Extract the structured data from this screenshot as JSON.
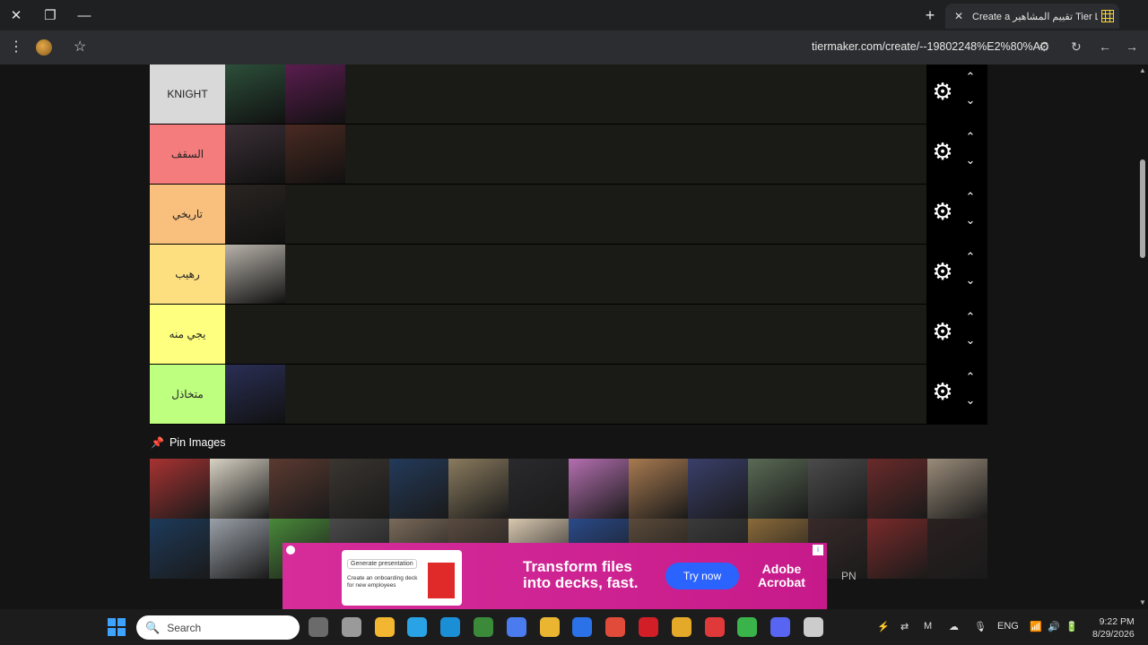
{
  "window": {
    "close_glyph": "✕",
    "restore_glyph": "❐",
    "minimize_glyph": "—"
  },
  "tab": {
    "title": "Create a تقييم المشاهير Tier List",
    "close_glyph": "✕",
    "new_tab_glyph": "+"
  },
  "address": {
    "url": "tiermaker.com/create/--19802248%E2%80%AC",
    "menu_glyph": "⋮",
    "star_glyph": "☆",
    "reload_glyph": "↻",
    "back_glyph": "←",
    "forward_glyph": "→",
    "tune_glyph": "⚙"
  },
  "tiers": [
    {
      "label": "KNIGHT",
      "color": "#d9d9d9",
      "images": [
        "#2c4f3a",
        "#5a1d4f"
      ]
    },
    {
      "label": "السقف",
      "color": "#f47c7c",
      "images": [
        "#3a2f35",
        "#4a2a22"
      ]
    },
    {
      "label": "تاريخي",
      "color": "#f9bf7c",
      "images": [
        "#2a2522"
      ]
    },
    {
      "label": "رهيب",
      "color": "#fddf7f",
      "images": [
        "#b7b2aa"
      ]
    },
    {
      "label": "يجي منه",
      "color": "#ffff7f",
      "images": []
    },
    {
      "label": "متخاذل",
      "color": "#bfff7f",
      "images": [
        "#2a2f55"
      ]
    }
  ],
  "tier_controls": {
    "gear_glyph": "⚙",
    "up_glyph": "⌃",
    "down_glyph": "⌄"
  },
  "pin": {
    "icon": "📌",
    "label": "Pin Images"
  },
  "pool_colors": [
    "#a83232",
    "#d8d2c4",
    "#5b3a30",
    "#3a3530",
    "#233a5a",
    "#8a7b5e",
    "#2a2a2e",
    "#b46fb0",
    "#a87a50",
    "#3a3f6a",
    "#5a6a55",
    "#4b4b4b",
    "#6a2a2a",
    "#9a8c7a",
    "#1d3a5a",
    "#9aa0a8",
    "#4a8a3a",
    "#4a4a4a",
    "#7a6a5a",
    "#5a4a40",
    "#d8c8b0",
    "#2a4a8a",
    "#5a4a3a",
    "#3a3a3a",
    "#8a6a3a",
    "#3a2a2a",
    "#7a2a2a",
    "#2a2020"
  ],
  "ad": {
    "card_chip": "Generate presentation",
    "card_text": "Create an onboarding deck for new employees",
    "headline_line1": "Transform files",
    "headline_line2": "into decks, fast.",
    "cta": "Try now",
    "brand_line1": "Adobe",
    "brand_line2": "Acrobat"
  },
  "side_text": "PN",
  "taskbar": {
    "search_placeholder": "Search",
    "search_icon": "🔍",
    "apps": [
      "#6b6b6b",
      "#9a9a9a",
      "#f2b630",
      "#2aa3e6",
      "#1b8fd6",
      "#3a8a3a",
      "#4a7cf0",
      "#eab631",
      "#2b72e8",
      "#e04b3a",
      "#d21f27",
      "#e5a92a",
      "#e0393a",
      "#3ab34a",
      "#5865f2",
      "#cccccc"
    ],
    "tray_lang": "ENG",
    "time": "9:22 PM",
    "date": "8/29/2026"
  }
}
